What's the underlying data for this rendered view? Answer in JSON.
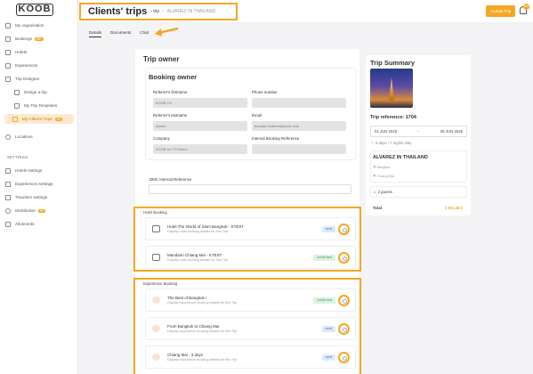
{
  "app": {
    "logo": "KOOB"
  },
  "sidebar": {
    "items": [
      {
        "label": "My organization"
      },
      {
        "label": "Bookings",
        "badge": "99+"
      },
      {
        "label": "Hotels"
      },
      {
        "label": "Experiences"
      },
      {
        "label": "Trip Designer"
      },
      {
        "label": "Design a trip"
      },
      {
        "label": "My Trip Templates"
      },
      {
        "label": "My Client's Trips",
        "badge": "99"
      },
      {
        "label": "Locations"
      }
    ],
    "settings_heading": "SETTINGS",
    "settings_items": [
      {
        "label": "Hotels settings"
      },
      {
        "label": "Experiences settings"
      },
      {
        "label": "Travelers settings"
      },
      {
        "label": "Distribution",
        "badge": "99"
      },
      {
        "label": "Allotments"
      }
    ]
  },
  "header": {
    "title": "Clients' trips",
    "crumb_sep": "›",
    "crumb_trip": "trip",
    "crumb_name": "ALVAREZ IN THAILAND",
    "update_label": "Update Trip",
    "bell_badge": "99+"
  },
  "tabs": [
    {
      "label": "Details"
    },
    {
      "label": "Documents"
    },
    {
      "label": "Chat"
    }
  ],
  "trip_owner": {
    "section_title": "Trip owner",
    "booking_owner_title": "Booking owner",
    "fields": {
      "referrer_firstname": {
        "label": "Referrer's firstname",
        "value": "KOOB TO"
      },
      "phone": {
        "label": "Phone number",
        "value": ""
      },
      "referrer_lastname": {
        "label": "Referrer's lastname",
        "value": "Admin"
      },
      "email": {
        "label": "Email",
        "value": "thomas+todemo@koob.com"
      },
      "company": {
        "label": "Company",
        "value": "KOOB for TO Demo"
      },
      "internal_ref": {
        "label": "Internal Booking Reference",
        "value": ""
      },
      "dmc_ref": {
        "label": "DMC Internal Reference",
        "value": ""
      }
    }
  },
  "hotel_booking": {
    "label": "Hotel Booking",
    "items": [
      {
        "title": "Hotel The World of Siam Bangkok - KTEST",
        "sub": "Display hotel booking details for this Trip",
        "status": "sent"
      },
      {
        "title": "Mandarin Chiang Mai - KTEST",
        "sub": "Display hotel booking details for this Trip",
        "status": "confirmed"
      }
    ]
  },
  "experience_booking": {
    "label": "Experience Booking",
    "items": [
      {
        "title": "The Best of Bangkok !",
        "sub": "Display experience booking details for this Trip",
        "status": "confirmed"
      },
      {
        "title": "From Bangkok to Chiang Mai",
        "sub": "Display experience booking details for this Trip",
        "status": "sent"
      },
      {
        "title": "Chiang Mai - 3 days",
        "sub": "Display experience booking details for this Trip",
        "status": "sent"
      }
    ]
  },
  "summary": {
    "title": "Trip Summary",
    "reference": "Trip reference: 1704",
    "start_date": "01 JUN 2025",
    "end_date": "06 JUN 2025",
    "duration": "6 days / 7 nights stay",
    "trip_name": "ALVAREZ IN THAILAND",
    "cities": [
      "Bangkok",
      "Chiang Mai"
    ],
    "guests": "2 guests",
    "total_label": "Total",
    "total_value": "2 811,36 €"
  },
  "colors": {
    "accent": "#f5a623"
  }
}
